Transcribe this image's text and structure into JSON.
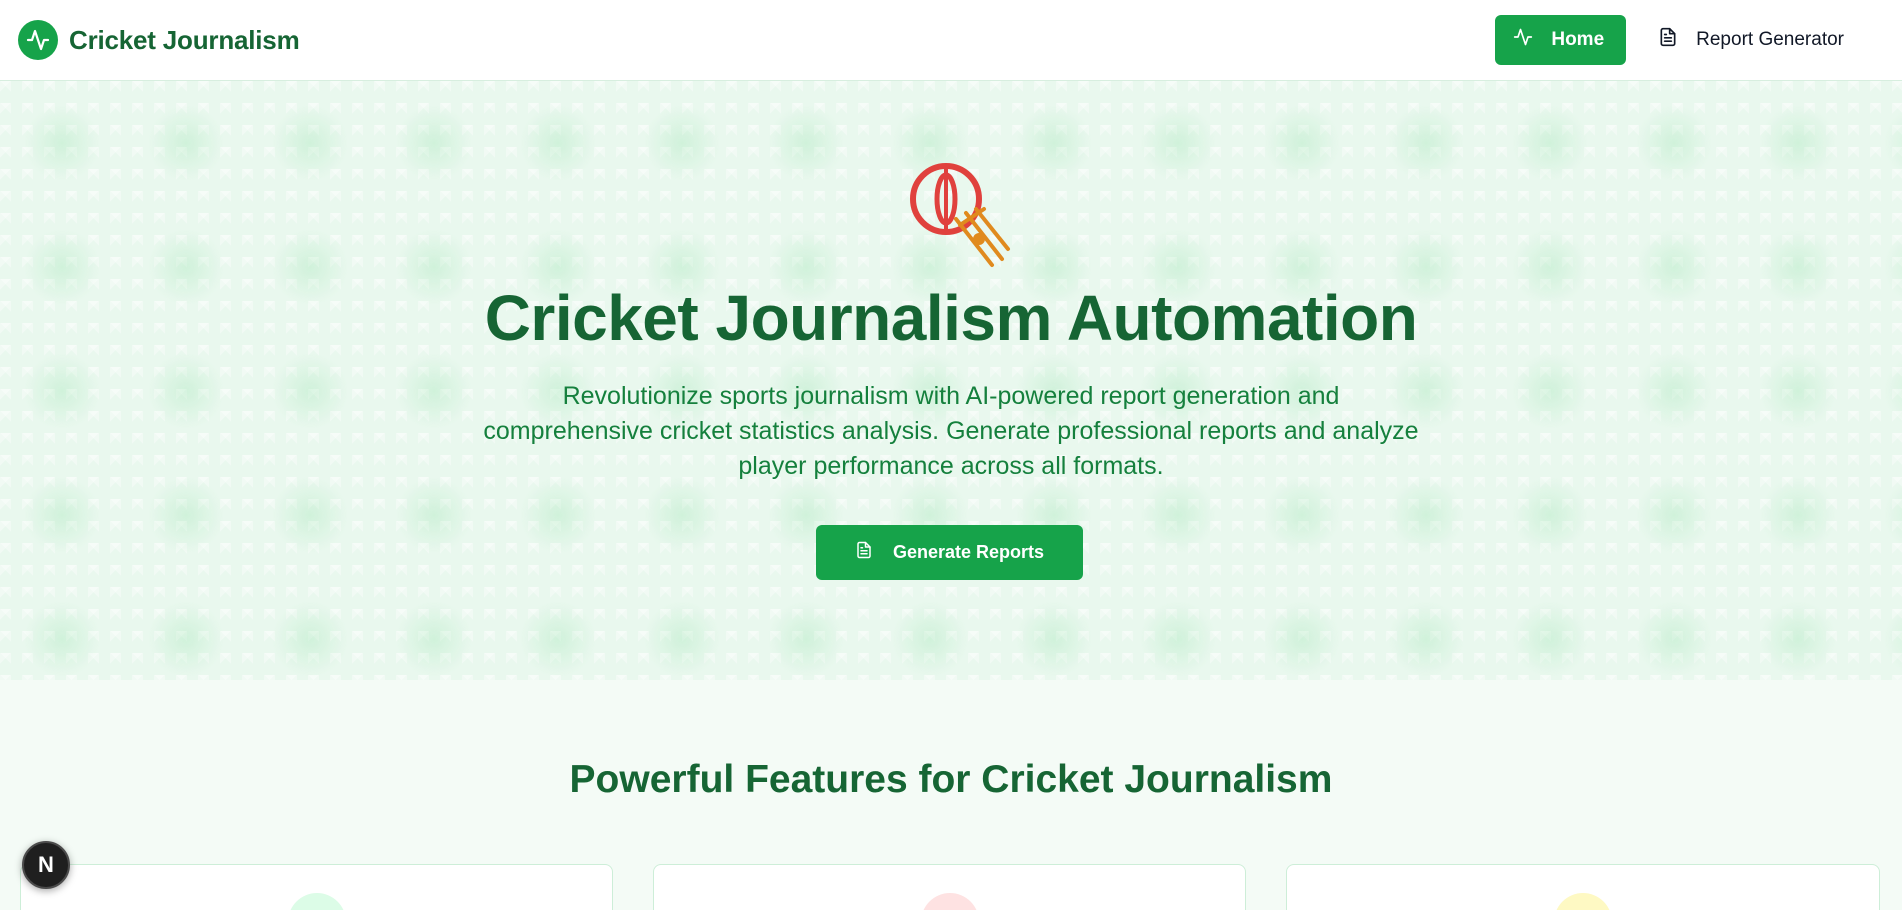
{
  "navbar": {
    "brand_name": "Cricket Journalism",
    "brand_icon": "activity-icon",
    "links": [
      {
        "label": "Home",
        "icon": "activity-icon",
        "active": true
      },
      {
        "label": "Report Generator",
        "icon": "file-text-icon",
        "active": false
      }
    ]
  },
  "hero": {
    "icon": "cricket-ball-and-stumps-icon",
    "title": "Cricket Journalism Automation",
    "subtitle": "Revolutionize sports journalism with AI-powered report generation and comprehensive cricket statistics analysis. Generate professional reports and analyze player performance across all formats.",
    "cta_label": "Generate Reports",
    "cta_icon": "file-text-icon"
  },
  "features": {
    "title": "Powerful Features for Cricket Journalism",
    "card_accent_colors": [
      "#dcfce7",
      "#fee2e2",
      "#fef9c3"
    ]
  },
  "dev_badge": {
    "label": "N"
  },
  "colors": {
    "primary": "#16a34a",
    "heading": "#166534",
    "hero_background": "#e9f8ee",
    "page_background": "#f4fbf6"
  }
}
